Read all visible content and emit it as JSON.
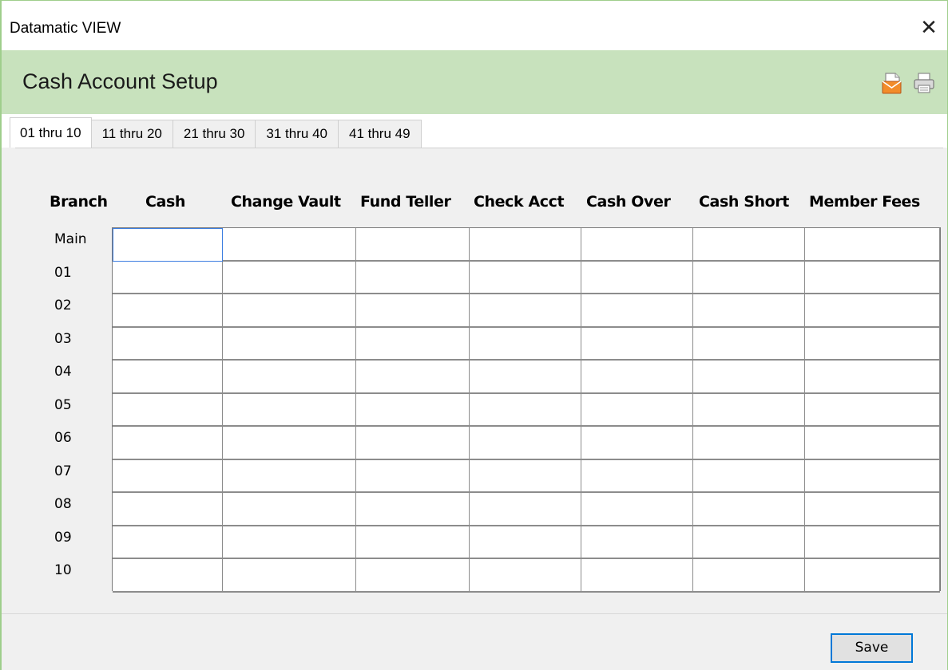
{
  "window": {
    "title": "Datamatic VIEW",
    "close_glyph": "✕"
  },
  "header": {
    "title": "Cash Account Setup",
    "icons": [
      "email-report-icon",
      "print-icon"
    ]
  },
  "tabs": [
    {
      "label": "01 thru 10",
      "active": true
    },
    {
      "label": "11 thru 20",
      "active": false
    },
    {
      "label": "21 thru 30",
      "active": false
    },
    {
      "label": "31 thru 40",
      "active": false
    },
    {
      "label": "41 thru 49",
      "active": false
    }
  ],
  "grid": {
    "columns": [
      "Branch",
      "Cash",
      "Change Vault",
      "Fund Teller",
      "Check Acct",
      "Cash Over",
      "Cash Short",
      "Member Fees"
    ],
    "rows": [
      "Main",
      "01",
      "02",
      "03",
      "04",
      "05",
      "06",
      "07",
      "08",
      "09",
      "10"
    ]
  },
  "footer": {
    "save_label": "Save"
  },
  "colors": {
    "header_bg": "#c8e2bd",
    "window_border": "#9fce8c",
    "focus_accent": "#0078d7"
  }
}
